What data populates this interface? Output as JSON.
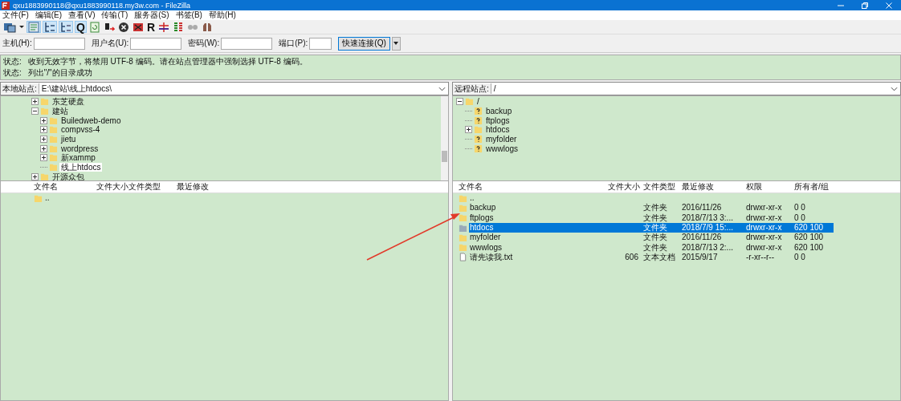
{
  "window": {
    "title": "qxu1883990118@qxu1883990118.my3w.com - FileZilla"
  },
  "menu": [
    "文件(F)",
    "编辑(E)",
    "查看(V)",
    "传输(T)",
    "服务器(S)",
    "书签(B)",
    "帮助(H)"
  ],
  "toolbar": [
    {
      "kind": "site-manager",
      "pressed": false
    },
    {
      "kind": "caret",
      "pressed": false
    },
    {
      "kind": "log",
      "pressed": true
    },
    {
      "kind": "tree-local",
      "pressed": true
    },
    {
      "kind": "tree-remote",
      "pressed": true
    },
    {
      "kind": "glyph",
      "text": "Q",
      "pressed": true
    },
    {
      "kind": "refresh",
      "pressed": false
    },
    {
      "kind": "filter",
      "pressed": false
    },
    {
      "kind": "cancel",
      "pressed": false
    },
    {
      "kind": "disconnect",
      "pressed": false
    },
    {
      "kind": "glyph",
      "text": "R",
      "pressed": false
    },
    {
      "kind": "compare",
      "pressed": false
    },
    {
      "kind": "sync",
      "pressed": false
    },
    {
      "kind": "link",
      "pressed": false
    },
    {
      "kind": "binoculars",
      "pressed": false
    }
  ],
  "quickconnect": {
    "fields": [
      {
        "label": "主机(H):",
        "kind": "wide"
      },
      {
        "label": "用户名(U):",
        "kind": "wide"
      },
      {
        "label": "密码(W):",
        "kind": "wide"
      },
      {
        "label": "端口(P):",
        "kind": "narrow"
      }
    ],
    "button": "快速连接(Q)"
  },
  "log": [
    {
      "label": "状态:",
      "message": "收到无效字节，将禁用 UTF-8 编码。请在站点管理器中强制选择 UTF-8 编码。"
    },
    {
      "label": "状态:",
      "message": "列出\"/\"的目录成功"
    }
  ],
  "local_site": {
    "label": "本地站点:",
    "path": "E:\\建站\\线上htdocs\\",
    "tree": [
      {
        "name": "东芝硬盘",
        "kind": "folder",
        "expanded": false,
        "selected": false
      },
      {
        "name": "建站",
        "kind": "folder",
        "expanded": true,
        "selected": false,
        "children": [
          {
            "name": "Builedweb-demo",
            "kind": "folder",
            "expanded": false,
            "selected": false
          },
          {
            "name": "compvss-4",
            "kind": "folder",
            "expanded": false,
            "selected": false
          },
          {
            "name": "jietu",
            "kind": "folder",
            "expanded": false,
            "selected": false
          },
          {
            "name": "wordpress",
            "kind": "folder",
            "expanded": false,
            "selected": false
          },
          {
            "name": "新xammp",
            "kind": "folder",
            "expanded": false,
            "selected": false
          },
          {
            "name": "线上htdocs",
            "kind": "folder",
            "selected": true
          }
        ]
      },
      {
        "name": "开源众包",
        "kind": "folder",
        "expanded": false,
        "selected": false
      }
    ],
    "columns": [
      "文件名",
      "文件大小",
      "文件类型",
      "最近修改"
    ],
    "rows": [
      {
        "kind": "folder",
        "cells": [
          ".."
        ],
        "selected": false
      }
    ]
  },
  "remote_site": {
    "label": "远程站点:",
    "path": "/",
    "tree": [
      {
        "name": "/",
        "kind": "folder",
        "expanded": true,
        "selected": false,
        "children": [
          {
            "name": "backup",
            "kind": "unknown",
            "selected": false
          },
          {
            "name": "ftplogs",
            "kind": "unknown",
            "selected": false
          },
          {
            "name": "htdocs",
            "kind": "folder",
            "expanded": false,
            "selected": false
          },
          {
            "name": "myfolder",
            "kind": "unknown",
            "selected": false
          },
          {
            "name": "wwwlogs",
            "kind": "unknown",
            "selected": false
          }
        ]
      }
    ],
    "columns": [
      "文件名",
      "文件大小",
      "文件类型",
      "最近修改",
      "权限",
      "所有者/组"
    ],
    "rows": [
      {
        "kind": "folder",
        "cells": [
          ".."
        ],
        "selected": false
      },
      {
        "kind": "folder",
        "cells": [
          "backup",
          "",
          "文件夹",
          "2016/11/26",
          "drwxr-xr-x",
          "0 0"
        ],
        "selected": false
      },
      {
        "kind": "folder",
        "cells": [
          "ftplogs",
          "",
          "文件夹",
          "2018/7/13 3:...",
          "drwxr-xr-x",
          "0 0"
        ],
        "selected": false
      },
      {
        "kind": "folder",
        "cells": [
          "htdocs",
          "",
          "文件夹",
          "2018/7/9 15:...",
          "drwxr-xr-x",
          "620 100"
        ],
        "selected": true
      },
      {
        "kind": "folder",
        "cells": [
          "myfolder",
          "",
          "文件夹",
          "2016/11/26",
          "drwxr-xr-x",
          "620 100"
        ],
        "selected": false
      },
      {
        "kind": "folder",
        "cells": [
          "wwwlogs",
          "",
          "文件夹",
          "2018/7/13 2:...",
          "drwxr-xr-x",
          "620 100"
        ],
        "selected": false
      },
      {
        "kind": "file",
        "cells": [
          "请先读我.txt",
          "606",
          "文本文档",
          "2015/9/17",
          "-r-xr--r--",
          "0 0"
        ],
        "selected": false
      }
    ]
  }
}
